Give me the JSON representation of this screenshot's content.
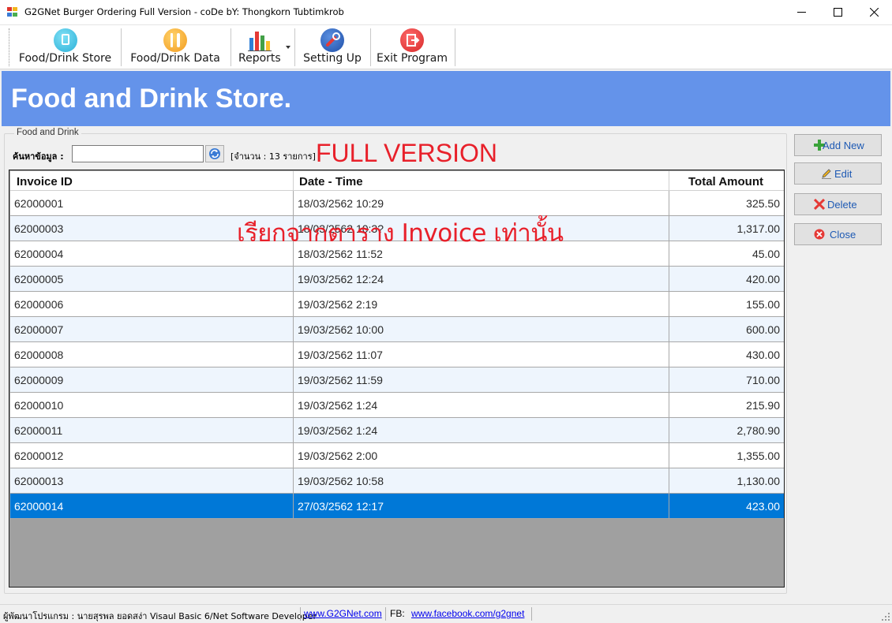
{
  "window": {
    "title": "G2GNet Burger Ordering Full Version - coDe bY: Thongkorn Tubtimkrob"
  },
  "toolbar": {
    "items": [
      {
        "label": "Food/Drink Store",
        "icon": "store-icon"
      },
      {
        "label": "Food/Drink Data",
        "icon": "food-data-icon"
      },
      {
        "label": "Reports",
        "icon": "bar-chart-icon"
      },
      {
        "label": "Setting Up",
        "icon": "wrench-icon"
      },
      {
        "label": "Exit Program",
        "icon": "exit-icon"
      }
    ]
  },
  "banner": {
    "title": "Food and Drink Store."
  },
  "group": {
    "legend": "Food and Drink"
  },
  "search": {
    "label": "ค้นหาข้อมูล :",
    "value": "",
    "count_text": "[จำนวน : 13 รายการ]"
  },
  "annotations": {
    "full_version": "FULL VERSION",
    "thai_note": "เรียกจากตาราง Invoice เท่านั้น"
  },
  "grid": {
    "headers": [
      "Invoice ID",
      "Date - Time",
      "Total Amount"
    ],
    "rows": [
      {
        "id": "62000001",
        "datetime": "18/03/2562 10:29",
        "amount": "325.50"
      },
      {
        "id": "62000003",
        "datetime": "18/03/2562 10:3?",
        "amount": "1,317.00"
      },
      {
        "id": "62000004",
        "datetime": "18/03/2562 11:52",
        "amount": "45.00"
      },
      {
        "id": "62000005",
        "datetime": "19/03/2562 12:24",
        "amount": "420.00"
      },
      {
        "id": "62000006",
        "datetime": "19/03/2562 2:19",
        "amount": "155.00"
      },
      {
        "id": "62000007",
        "datetime": "19/03/2562 10:00",
        "amount": "600.00"
      },
      {
        "id": "62000008",
        "datetime": "19/03/2562 11:07",
        "amount": "430.00"
      },
      {
        "id": "62000009",
        "datetime": "19/03/2562 11:59",
        "amount": "710.00"
      },
      {
        "id": "62000010",
        "datetime": "19/03/2562 1:24",
        "amount": "215.90"
      },
      {
        "id": "62000011",
        "datetime": "19/03/2562 1:24",
        "amount": "2,780.90"
      },
      {
        "id": "62000012",
        "datetime": "19/03/2562 2:00",
        "amount": "1,355.00"
      },
      {
        "id": "62000013",
        "datetime": "19/03/2562 10:58",
        "amount": "1,130.00"
      },
      {
        "id": "62000014",
        "datetime": "27/03/2562 12:17",
        "amount": "423.00"
      }
    ],
    "selected_index": 12
  },
  "side_buttons": {
    "add_new": "Add New",
    "edit": "Edit",
    "delete": "Delete",
    "close": "Close"
  },
  "statusbar": {
    "developer": "ผู้พัฒนาโปรแกรม : นายสุรพล ยอดสง่า Visaul Basic 6/Net Software Developer",
    "site_link": "www.G2GNet.com",
    "fb_label": "FB:",
    "fb_link": "www.facebook.com/g2gnet"
  },
  "colors": {
    "banner": "#6493ea",
    "selected_row": "#0078d7",
    "annotation_red": "#e8202a",
    "alt_row": "#eef5fd"
  }
}
